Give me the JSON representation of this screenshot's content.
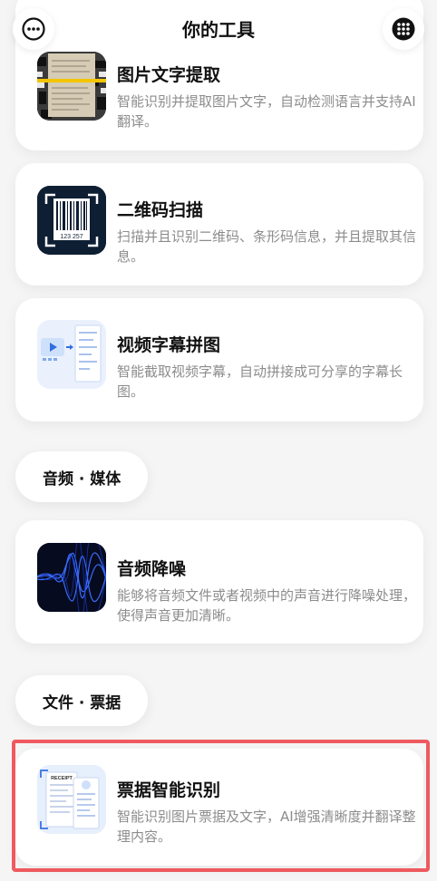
{
  "header": {
    "title": "你的工具",
    "more_icon": "more-icon",
    "grid_icon": "grid-dots-icon"
  },
  "tools": [
    {
      "title": "图片文字提取",
      "desc": "智能识别并提取图片文字，自动检测语言并支持AI翻译。",
      "icon": "document-scan-thumb"
    },
    {
      "title": "二维码扫描",
      "desc": "扫描并且识别二维码、条形码信息，并且提取其信息。",
      "icon": "barcode-thumb",
      "barcode_number": "123 257"
    },
    {
      "title": "视频字幕拼图",
      "desc": "智能截取视频字幕，自动拼接成可分享的字幕长图。",
      "icon": "video-subtitle-thumb"
    }
  ],
  "sections": [
    {
      "label": "音频 · 媒体",
      "tools": [
        {
          "title": "音频降噪",
          "desc": "能够将音频文件或者视频中的声音进行降噪处理，使得声音更加清晰。",
          "icon": "audio-wave-thumb"
        }
      ]
    },
    {
      "label": "文件 · 票据",
      "tools": [
        {
          "title": "票据智能识别",
          "desc": "智能识别图片票据及文字，AI增强清晰度并翻译整理内容。",
          "icon": "receipt-thumb",
          "receipt_word": "RECEIPT"
        }
      ]
    }
  ]
}
